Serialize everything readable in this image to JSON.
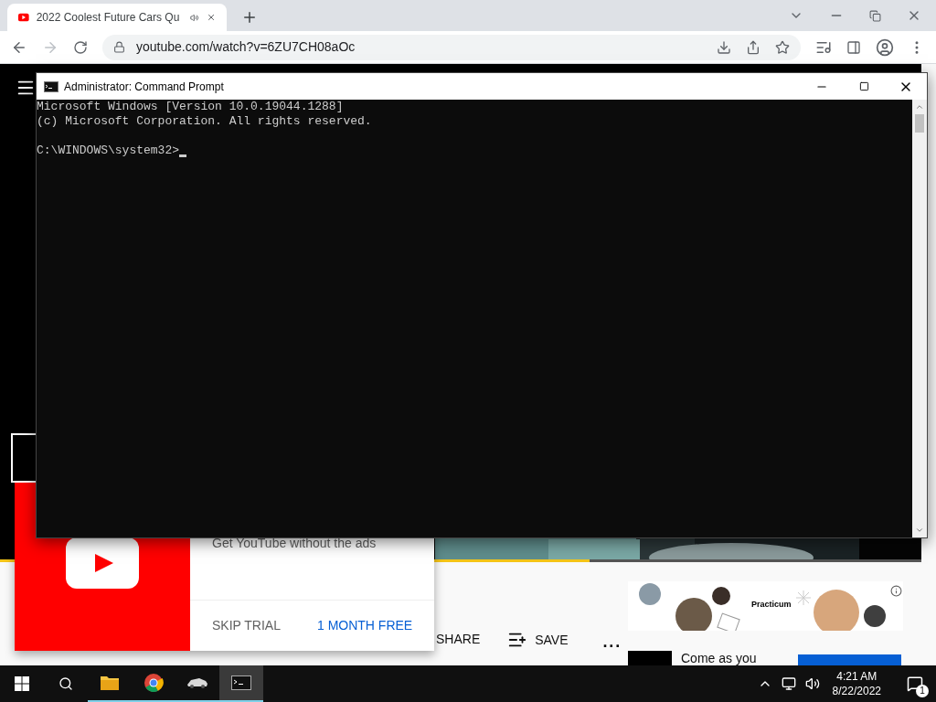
{
  "browser": {
    "tab": {
      "title": "2022 Coolest Future Cars Qu",
      "selected": true
    },
    "url": "youtube.com/watch?v=6ZU7CH08aOc"
  },
  "video": {
    "progress": {
      "level": 0.64
    }
  },
  "premium_popup": {
    "text": "Get YouTube without the ads",
    "buttons": [
      {
        "label": "SKIP TRIAL",
        "kind": "plain"
      },
      {
        "label": "1 MONTH FREE",
        "kind": "primary"
      }
    ]
  },
  "actions": [
    {
      "label": "SHARE",
      "kind": "share"
    },
    {
      "label": "SAVE",
      "kind": "save"
    },
    {
      "label": "...",
      "kind": "more"
    }
  ],
  "ad": {
    "brand": "Practicum"
  },
  "next_video": {
    "title": "Come as you"
  },
  "cmd": {
    "title": "Administrator: Command Prompt",
    "lines": [
      "Microsoft Windows [Version 10.0.19044.1288]",
      "(c) Microsoft Corporation. All rights reserved."
    ],
    "prompt": "C:\\WINDOWS\\system32>"
  },
  "taskbar": {
    "apps": [
      {
        "kind": "explorer",
        "selected": false
      },
      {
        "kind": "chrome",
        "selected": false
      },
      {
        "kind": "car",
        "selected": false
      },
      {
        "kind": "cmd",
        "selected": true
      }
    ],
    "time": "4:21 AM",
    "date": "8/22/2022",
    "notifications": "1"
  }
}
